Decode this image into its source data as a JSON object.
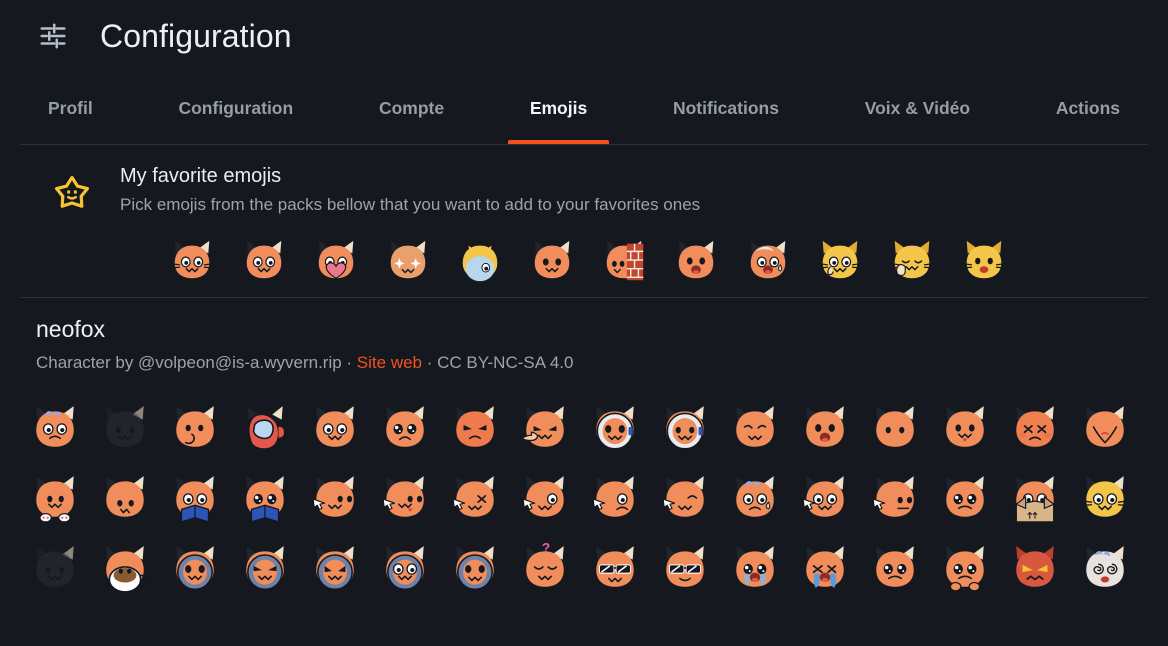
{
  "window": {
    "title": "Configuration",
    "icon": "tune-sliders-icon",
    "background": "#15191f",
    "accent": "#f4511e"
  },
  "tabs": [
    {
      "id": "profil",
      "label": "Profil",
      "active": false
    },
    {
      "id": "configuration",
      "label": "Configuration",
      "active": false
    },
    {
      "id": "compte",
      "label": "Compte",
      "active": false
    },
    {
      "id": "emojis",
      "label": "Emojis",
      "active": true
    },
    {
      "id": "notifications",
      "label": "Notifications",
      "active": false
    },
    {
      "id": "voix-video",
      "label": "Voix & Vidéo",
      "active": false
    },
    {
      "id": "actions",
      "label": "Actions",
      "active": false
    }
  ],
  "favorites": {
    "icon": "star-face-icon",
    "icon_color": "#f5c432",
    "title": "My favorite emojis",
    "subtitle": "Pick emojis from the packs bellow that you want to add to your favorites ones",
    "emojis": [
      {
        "name": "neocat",
        "kind": "cat",
        "base": "#f08d5a",
        "face": "owo",
        "ears": "dark"
      },
      {
        "name": "neofox",
        "kind": "fox",
        "base": "#f08d5a",
        "face": "owo",
        "ears": "dark"
      },
      {
        "name": "neofox_heart",
        "kind": "fox",
        "base": "#f08d5a",
        "face": "heart",
        "ears": "dark"
      },
      {
        "name": "neofox_sparkle",
        "kind": "fox",
        "base": "#e9a06d",
        "face": "sparkle",
        "ears": "tan"
      },
      {
        "name": "neocat_sad_pat",
        "kind": "bird",
        "base": "#f3c64a",
        "face": "pat",
        "ears": "none"
      },
      {
        "name": "neocat_pumpkin",
        "kind": "cat",
        "base": "#f08d5a",
        "face": "jack",
        "ears": "dark"
      },
      {
        "name": "neofox_wall",
        "kind": "wall",
        "base": "#f08d5a",
        "face": "peek",
        "ears": "dark"
      },
      {
        "name": "neofox_scream",
        "kind": "fox",
        "base": "#f08d5a",
        "face": "scream",
        "ears": "dark"
      },
      {
        "name": "neofox_scared_sweat",
        "kind": "fox",
        "base": "#f08d5a",
        "face": "sweatscream",
        "ears": "dark"
      },
      {
        "name": "neocat_shy",
        "kind": "cat",
        "base": "#f3c64a",
        "face": "shy",
        "ears": "yellow"
      },
      {
        "name": "neocat_thumbsup",
        "kind": "cat",
        "base": "#f3c64a",
        "face": "thumbsup",
        "ears": "yellow"
      },
      {
        "name": "neocat_surprised",
        "kind": "cat",
        "base": "#f3c64a",
        "face": "surprised",
        "ears": "yellow"
      }
    ]
  },
  "pack": {
    "name": "neofox",
    "meta_prefix": "Character by @volpeon@is-a.wyvern.rip",
    "separator": " · ",
    "link_label": "Site web",
    "license": "CC BY-NC-SA 4.0",
    "columns": 16,
    "emojis": [
      {
        "name": "neofox_3c",
        "kind": "fox",
        "base": "#f08d5a",
        "face": "sad",
        "ears": "dark",
        "hair": "blue"
      },
      {
        "name": "neofox_adult_only",
        "kind": "fox",
        "base": "#2a2f36",
        "face": "blank",
        "ears": "dark",
        "dim": true
      },
      {
        "name": "neofox_aww",
        "kind": "fox",
        "base": "#f08d5a",
        "face": "aww",
        "ears": "dark"
      },
      {
        "name": "neofox_amongus",
        "kind": "sus",
        "base": "#e4574a",
        "face": "sus",
        "ears": "dark"
      },
      {
        "name": "neofox_angel",
        "kind": "fox",
        "base": "#f08d5a",
        "face": "owo",
        "ears": "dark",
        "halo": true
      },
      {
        "name": "neofox_angel_sad",
        "kind": "fox",
        "base": "#f08d5a",
        "face": "sadbig",
        "ears": "dark",
        "halo": true
      },
      {
        "name": "neofox_angry",
        "kind": "fox",
        "base": "#ef7a4e",
        "face": "angry",
        "ears": "dark"
      },
      {
        "name": "neofox_angry_point",
        "kind": "fox",
        "base": "#f08d5a",
        "face": "point",
        "ears": "dark"
      },
      {
        "name": "neofox_astronaut",
        "kind": "helm",
        "base": "#f08d5a",
        "face": "jack",
        "ears": "dark"
      },
      {
        "name": "neofox_astronaut_2",
        "kind": "helm",
        "base": "#f08d5a",
        "face": "jackpoint",
        "ears": "dark"
      },
      {
        "name": "neofox_awoo",
        "kind": "fox",
        "base": "#f08d5a",
        "face": "awoo",
        "ears": "dark"
      },
      {
        "name": "neofox_scream2",
        "kind": "fox",
        "base": "#f08d5a",
        "face": "scream",
        "ears": "dark"
      },
      {
        "name": "neofox_blank",
        "kind": "fox",
        "base": "#f08d5a",
        "face": "dots",
        "ears": "dark"
      },
      {
        "name": "neofox_blep",
        "kind": "fox",
        "base": "#f08d5a",
        "face": "blep",
        "ears": "dark"
      },
      {
        "name": "neofox_angry_blush",
        "kind": "fox",
        "base": "#ef8050",
        "face": "xeyes",
        "ears": "dark"
      },
      {
        "name": "neofox_bongo",
        "kind": "fox",
        "base": "#f08d5a",
        "face": "bongo",
        "ears": "dark"
      },
      {
        "name": "neofox_paws",
        "kind": "paws",
        "base": "#f08d5a",
        "face": "paws",
        "ears": "dark"
      },
      {
        "name": "neofox_peek",
        "kind": "peek",
        "base": "#f08d5a",
        "face": "peekbottom",
        "ears": "dark"
      },
      {
        "name": "neofox_book",
        "kind": "book",
        "base": "#f08d5a",
        "face": "book",
        "ears": "dark"
      },
      {
        "name": "neofox_book_2",
        "kind": "book",
        "base": "#f08d5a",
        "face": "bookbig",
        "ears": "dark"
      },
      {
        "name": "neofox_cursor",
        "kind": "fox",
        "base": "#f08d5a",
        "face": "cursor",
        "ears": "dark"
      },
      {
        "name": "neofox_cursor_2",
        "kind": "fox",
        "base": "#f08d5a",
        "face": "cursorblep",
        "ears": "dark"
      },
      {
        "name": "neofox_cursor_3",
        "kind": "fox",
        "base": "#f08d5a",
        "face": "cursorx",
        "ears": "dark"
      },
      {
        "name": "neofox_cursor_4",
        "kind": "fox",
        "base": "#f08d5a",
        "face": "cursorowo",
        "ears": "dark"
      },
      {
        "name": "neofox_cursor_5",
        "kind": "fox",
        "base": "#f08d5a",
        "face": "cursorsad",
        "ears": "dark"
      },
      {
        "name": "neofox_cursor_6",
        "kind": "fox",
        "base": "#f08d5a",
        "face": "cursorsly",
        "ears": "dark"
      },
      {
        "name": "neofox_cry_sweat",
        "kind": "fox",
        "base": "#f08d5a",
        "face": "crysweat",
        "ears": "dark",
        "hair": "blue"
      },
      {
        "name": "neofox_cursor_7",
        "kind": "fox",
        "base": "#f08d5a",
        "face": "cursorowo2",
        "ears": "dark"
      },
      {
        "name": "neofox_cursor_8",
        "kind": "fox",
        "base": "#f08d5a",
        "face": "cursorflat",
        "ears": "dark"
      },
      {
        "name": "neofox_pleading",
        "kind": "fox",
        "base": "#f08d5a",
        "face": "plead",
        "ears": "dark"
      },
      {
        "name": "neofox_box",
        "kind": "box",
        "base": "#f08d5a",
        "face": "boxpeek",
        "ears": "dark"
      },
      {
        "name": "neofox_cat_hybrid",
        "kind": "cat",
        "base": "#f3c64a",
        "face": "owo",
        "ears": "dark"
      },
      {
        "name": "neofox_black",
        "kind": "cat",
        "base": "#2a2f36",
        "face": "blank",
        "ears": "dark",
        "dim": true
      },
      {
        "name": "neofox_coffee",
        "kind": "mug",
        "base": "#f08d5a",
        "face": "mug",
        "ears": "dark"
      },
      {
        "name": "neofox_hoodie",
        "kind": "hood",
        "base": "#f08d5a",
        "face": "jack",
        "ears": "dark"
      },
      {
        "name": "neofox_hoodie_evil",
        "kind": "hood",
        "base": "#f08d5a",
        "face": "evil",
        "ears": "dark"
      },
      {
        "name": "neofox_hoodie_2",
        "kind": "hood",
        "base": "#f08d5a",
        "face": "jack2",
        "ears": "dark"
      },
      {
        "name": "neofox_hoodie_3",
        "kind": "hood",
        "base": "#f08d5a",
        "face": "owo",
        "ears": "dark"
      },
      {
        "name": "neofox_hoodie_4",
        "kind": "hood",
        "base": "#f08d5a",
        "face": "jack3",
        "ears": "dark"
      },
      {
        "name": "neofox_confused",
        "kind": "fox",
        "base": "#f08d5a",
        "face": "question",
        "ears": "dark"
      },
      {
        "name": "neofox_sunglasses",
        "kind": "fox",
        "base": "#f08d5a",
        "face": "shades",
        "ears": "dark"
      },
      {
        "name": "neofox_sunglasses_2",
        "kind": "fox",
        "base": "#f08d5a",
        "face": "shades2",
        "ears": "dark"
      },
      {
        "name": "neofox_cry",
        "kind": "fox",
        "base": "#f08d5a",
        "face": "cry",
        "ears": "dark"
      },
      {
        "name": "neofox_cry_2",
        "kind": "fox",
        "base": "#f08d5a",
        "face": "cryhard",
        "ears": "dark"
      },
      {
        "name": "neofox_cry_3",
        "kind": "fox",
        "base": "#f08d5a",
        "face": "plead",
        "ears": "dark"
      },
      {
        "name": "neofox_cry_4",
        "kind": "fox",
        "base": "#f08d5a",
        "face": "pleadpaws",
        "ears": "dark"
      },
      {
        "name": "neofox_devil",
        "kind": "fox",
        "base": "#d9563f",
        "face": "devil",
        "ears": "devil"
      },
      {
        "name": "neofox_dizzy",
        "kind": "fox",
        "base": "#e8e2dd",
        "face": "dizzy",
        "ears": "dark",
        "hair": "blue"
      }
    ]
  }
}
